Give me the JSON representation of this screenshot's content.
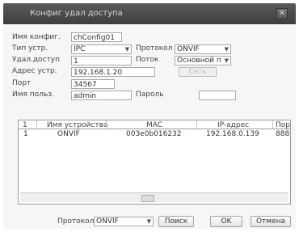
{
  "window": {
    "title": "Конфиг удал доступа",
    "close": "✕"
  },
  "form": {
    "config_name_label": "Имя конфиг.",
    "config_name_value": "chConfig01",
    "device_type_label": "Тип устр.",
    "device_type_value": "IPC",
    "protocol_label": "Протокол",
    "protocol_value": "ONVIF",
    "remote_access_label": "Удал.доступ",
    "remote_access_value": "1",
    "stream_label": "Поток",
    "stream_value": "Основной п",
    "device_addr_label": "Адрес устр.",
    "device_addr_value": "192.168.1.20",
    "network_button": "Сеть",
    "port_label": "Порт",
    "port_value": "34567",
    "username_label": "Имя польз.",
    "username_value": "admin",
    "password_label": "Пароль",
    "password_value": ""
  },
  "table": {
    "headers": [
      "1",
      "Имя устройства",
      "MAC",
      "IP-адрес",
      "Пор"
    ],
    "rows": [
      {
        "num": "1",
        "name": "ONVIF",
        "mac": "003e0b016232",
        "ip": "192.168.0.139",
        "port": "888"
      }
    ]
  },
  "footer": {
    "protocol_label": "Протокол",
    "protocol_value": "ONVIF",
    "search_button": "Поиск",
    "ok_button": "OK",
    "cancel_button": "Отмена"
  }
}
